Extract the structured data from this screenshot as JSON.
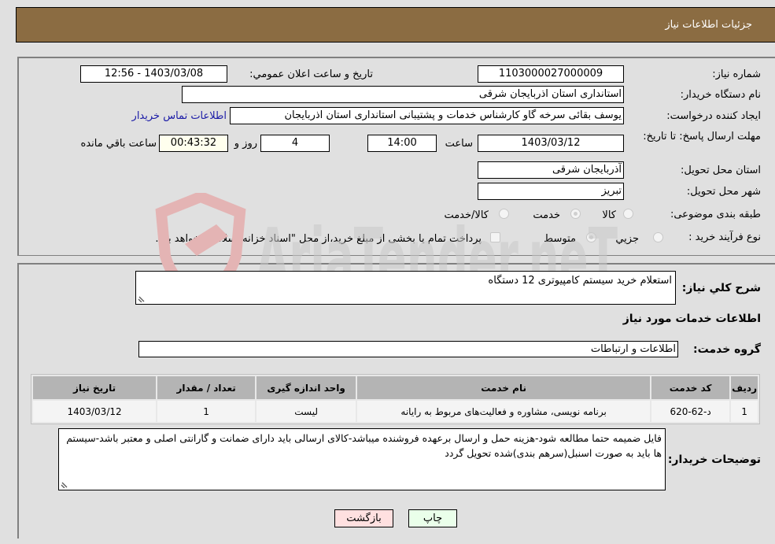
{
  "header": {
    "title": "جزئیات اطلاعات نیاز"
  },
  "form": {
    "need_number": {
      "label": "شماره نیاز:",
      "value": "1103000027000009"
    },
    "announce_datetime": {
      "label": "تاریخ و ساعت اعلان عمومي:",
      "value": "1403/03/08 - 12:56"
    },
    "buyer_org": {
      "label": "نام دستگاه خریدار:",
      "value": "استانداری استان اذربایجان شرقی"
    },
    "requester": {
      "label": "ایجاد کننده درخواست:",
      "value": "یوسف بقائی سرخه گاو کارشناس خدمات و پشتیبانی استانداری استان اذربایجان",
      "contact_link": "اطلاعات تماس خریدار"
    },
    "deadline": {
      "label": "مهلت ارسال پاسخ: تا تاریخ:",
      "date": "1403/03/12",
      "time_label": "ساعت",
      "time": "14:00",
      "days": "4",
      "days_label": "روز و",
      "remaining": "00:43:32",
      "remaining_label": "ساعت باقي مانده"
    },
    "delivery_province": {
      "label": "استان محل تحویل:",
      "value": "آذربایجان شرقی"
    },
    "delivery_city": {
      "label": "شهر محل تحویل:",
      "value": "تبریز"
    },
    "category": {
      "label": "طبقه بندی موضوعی:",
      "options": [
        "کالا",
        "خدمت",
        "کالا/خدمت"
      ],
      "selected": "خدمت"
    },
    "purchase_process": {
      "label": "نوع فرآیند خرید :",
      "options": [
        "جزيي",
        "متوسط"
      ],
      "selected": "متوسط",
      "treasury_note": "پرداخت تمام یا بخشی از مبلغ خرید،از محل \"اسناد خزانه اسلامی\" خواهد بود."
    }
  },
  "details": {
    "description_label": "شرح کلي نیاز:",
    "description": "استعلام خرید سیستم کامپیوتری 12 دستگاه",
    "services_heading": "اطلاعات خدمات مورد نیاز",
    "service_group_label": "گروه خدمت:",
    "service_group": "اطلاعات و ارتباطات",
    "table": {
      "headers": [
        "ردیف",
        "کد خدمت",
        "نام خدمت",
        "واحد اندازه گیری",
        "تعداد / مقدار",
        "تاریخ نیاز"
      ],
      "rows": [
        [
          "1",
          "د-62-620",
          "برنامه نویسی، مشاوره و فعالیت‌های مربوط به رایانه",
          "لیست",
          "1",
          "1403/03/12"
        ]
      ]
    },
    "buyer_notes_label": "توضیحات خریدار:",
    "buyer_notes": "فایل ضمیمه حتما مطالعه شود-هزینه حمل و ارسال برعهده فروشنده میباشد-کالای ارسالی باید دارای ضمانت و گارانتی اصلی و معتبر باشد-سیستم ها باید به صورت اسنبل(سرهم بندی)شده تحویل گردد"
  },
  "buttons": {
    "print": "چاپ",
    "back": "بازگشت"
  },
  "watermark": {
    "text": "AriaTender.neT"
  },
  "colors": {
    "header_bg": "#8b6c42",
    "link": "#1a1aa6",
    "back_btn": "#ffe0e0",
    "print_btn": "#eaffea"
  }
}
